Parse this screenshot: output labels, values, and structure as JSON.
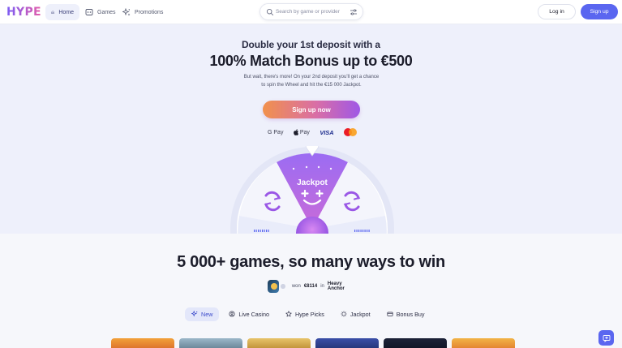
{
  "header": {
    "logo": "HYPE",
    "nav": [
      {
        "label": "Home",
        "icon": "home-icon",
        "active": true
      },
      {
        "label": "Games",
        "icon": "games-icon",
        "active": false
      },
      {
        "label": "Promotions",
        "icon": "sparkle-icon",
        "active": false
      }
    ],
    "search": {
      "placeholder": "Search by game or provider"
    },
    "login_label": "Log in",
    "signup_label": "Sign up"
  },
  "hero": {
    "subtitle": "Double your 1st deposit with a",
    "title": "100% Match Bonus up to €500",
    "description_line1": "But wait, there's more! On your 2nd deposit you'll get a chance",
    "description_line2": "to spin the Wheel and hit the €15 000 Jackpot.",
    "cta_label": "Sign up now",
    "payments": [
      "G Pay",
      "Pay",
      "VISA"
    ],
    "wheel_label": "Jackpot"
  },
  "games": {
    "title": "5 000+ games, so many ways to win",
    "winner": {
      "prefix": "won",
      "amount": "€8114",
      "connector": "in",
      "game": "Heavy Anchor"
    },
    "tabs": [
      {
        "label": "New",
        "icon": "sparkle-icon",
        "active": true
      },
      {
        "label": "Live Casino",
        "icon": "live-icon",
        "active": false
      },
      {
        "label": "Hype Picks",
        "icon": "star-icon",
        "active": false
      },
      {
        "label": "Jackpot",
        "icon": "jackpot-icon",
        "active": false
      },
      {
        "label": "Bonus Buy",
        "icon": "bonus-icon",
        "active": false
      }
    ]
  },
  "colors": {
    "accent": "#5a66f0",
    "hero_bg": "#eef0fb",
    "cta_gradient_start": "#f1914c",
    "cta_gradient_end": "#9f58e6"
  }
}
